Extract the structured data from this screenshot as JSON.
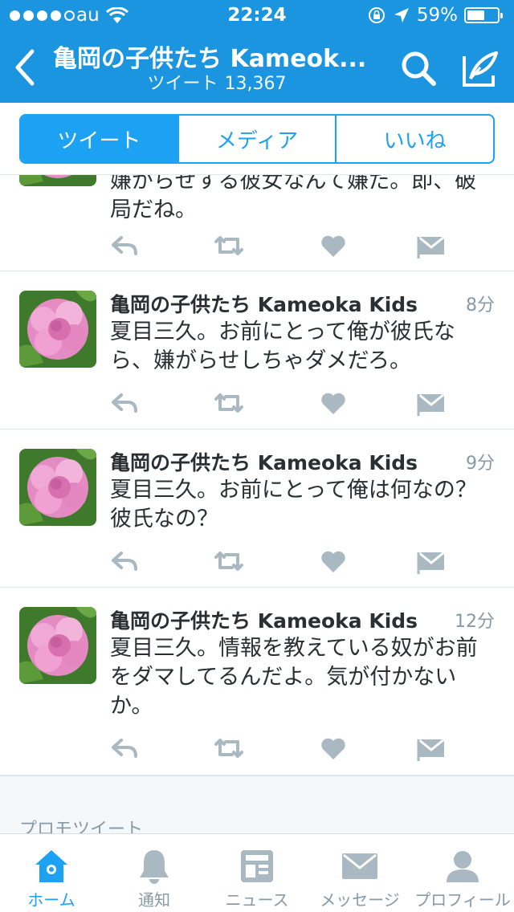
{
  "status_bar": {
    "carrier": "au",
    "time": "22:24",
    "battery": "59%",
    "battery_level": 0.59
  },
  "nav": {
    "title": "亀岡の子供たち Kameok...",
    "subtitle_label": "ツイート",
    "subtitle_count": "13,367"
  },
  "segments": [
    {
      "label": "ツイート",
      "active": true
    },
    {
      "label": "メディア",
      "active": false
    },
    {
      "label": "いいね",
      "active": false
    }
  ],
  "tweets": [
    {
      "name": "",
      "time": "",
      "text": "嫌がらせする彼女なんて嫌だ。即、破局だね。"
    },
    {
      "name": "亀岡の子供たち Kameoka Kids",
      "time": "8分",
      "text": "夏目三久。お前にとって俺が彼氏なら、嫌がらせしちゃダメだろ。"
    },
    {
      "name": "亀岡の子供たち Kameoka Kids",
      "time": "9分",
      "text": "夏目三久。お前にとって俺は何なの？彼氏なの？"
    },
    {
      "name": "亀岡の子供たち Kameoka Kids",
      "time": "12分",
      "text": "夏目三久。情報を教えている奴がお前をダマしてるんだよ。気が付かないか。"
    }
  ],
  "promo_label": "プロモツイート",
  "tabs": [
    {
      "label": "ホーム",
      "icon": "home-icon",
      "active": true
    },
    {
      "label": "通知",
      "icon": "bell-icon",
      "active": false
    },
    {
      "label": "ニュース",
      "icon": "news-icon",
      "active": false
    },
    {
      "label": "メッセージ",
      "icon": "envelope-icon",
      "active": false
    },
    {
      "label": "プロフィール",
      "icon": "person-icon",
      "active": false
    }
  ],
  "colors": {
    "brand": "#1b95e0",
    "accent": "#1da1f2",
    "icon_gray": "#aab8c2",
    "muted_text": "#8899a6"
  }
}
